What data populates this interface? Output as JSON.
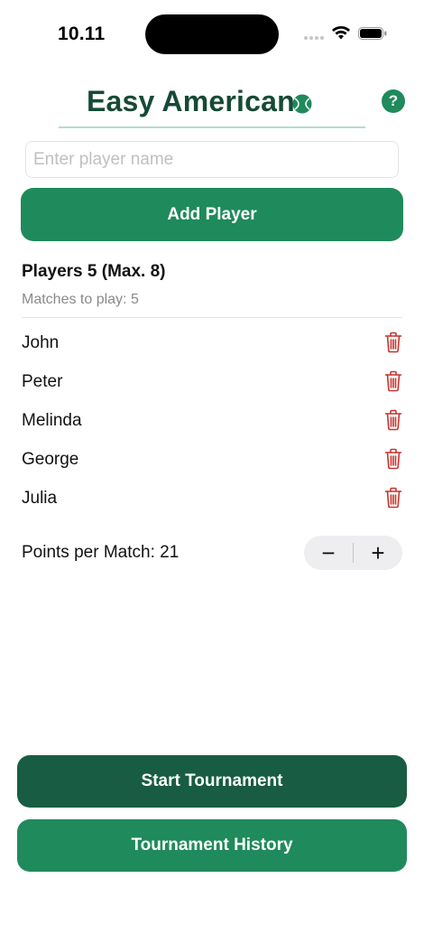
{
  "status_bar": {
    "time": "10.11",
    "icons": [
      "signal-icon",
      "wifi-icon",
      "battery-icon"
    ]
  },
  "header": {
    "title": "Easy American",
    "help_label": "?",
    "icons": [
      "tennis-ball-icon"
    ]
  },
  "form": {
    "name_placeholder": "Enter player name",
    "name_value": "",
    "add_player_label": "Add Player"
  },
  "players": {
    "heading": "Players 5 (Max. 8)",
    "matches_label": "Matches to play: 5",
    "list": [
      {
        "name": "John"
      },
      {
        "name": "Peter"
      },
      {
        "name": "Melinda"
      },
      {
        "name": "George"
      },
      {
        "name": "Julia"
      }
    ]
  },
  "settings": {
    "points_label": "Points per Match: 21",
    "minus_label": "−",
    "plus_label": "+"
  },
  "actions": {
    "start_label": "Start Tournament",
    "history_label": "Tournament History"
  },
  "colors": {
    "primary": "#1f8a5b",
    "primary_dark": "#175c43",
    "title": "#164a36",
    "delete": "#c8352e"
  }
}
